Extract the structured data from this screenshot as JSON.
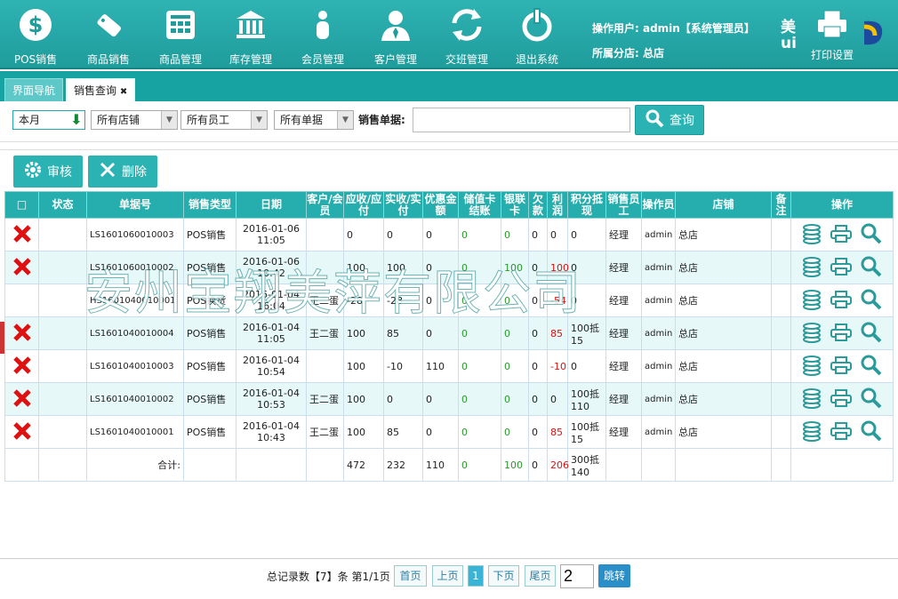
{
  "nav": [
    {
      "label": "POS销售",
      "icon": "dollar-icon"
    },
    {
      "label": "商品销售",
      "icon": "tag-icon"
    },
    {
      "label": "商品管理",
      "icon": "grid-icon"
    },
    {
      "label": "库存管理",
      "icon": "bank-icon"
    },
    {
      "label": "会员管理",
      "icon": "member-icon"
    },
    {
      "label": "客户管理",
      "icon": "customer-icon"
    },
    {
      "label": "交班管理",
      "icon": "swap-icon"
    },
    {
      "label": "退出系统",
      "icon": "exit-icon"
    }
  ],
  "user": {
    "operator": "操作用户: admin【系统管理员】",
    "branch": "所属分店: 总店"
  },
  "brand": "美ui",
  "print_label": "打印设置",
  "tabs": {
    "nav": "界面导航",
    "sales": "销售查询",
    "close": "✖"
  },
  "filters": {
    "month": "本月",
    "store": "所有店铺",
    "employee": "所有员工",
    "doc": "所有单据",
    "doc_label": "销售单据:",
    "doc_value": "",
    "query": "查询"
  },
  "actions": {
    "audit": "审核",
    "delete": "删除"
  },
  "columns": [
    "",
    "状态",
    "单据号",
    "销售类型",
    "日期",
    "客户/会员",
    "应收/应付",
    "实收/实付",
    "优惠金额",
    "储值卡结账",
    "银联卡",
    "欠款",
    "利润",
    "积分抵现",
    "销售员工",
    "操作员",
    "店铺",
    "备注",
    "操作"
  ],
  "rows": [
    {
      "del": true,
      "status": "",
      "no": "LS1601060010003",
      "type": "POS销售",
      "date": "2016-01-06",
      "time": "11:05",
      "cust": "",
      "due": "0",
      "paid": "0",
      "disc": "0",
      "card": "0",
      "union": "0",
      "debt": "0",
      "profit": "0",
      "points": "0",
      "staff": "经理",
      "op": "admin",
      "store": "总店",
      "note": ""
    },
    {
      "del": true,
      "status": "",
      "no": "LS1601060010002",
      "type": "POS销售",
      "date": "2016-01-06",
      "time": "10:42",
      "cust": "",
      "due": "100",
      "paid": "100",
      "disc": "0",
      "card": "0",
      "union": "100",
      "debt": "0",
      "profit": "100",
      "points": "0",
      "staff": "经理",
      "op": "admin",
      "store": "总店",
      "note": ""
    },
    {
      "del": false,
      "status": "",
      "no": "HS1601040010001",
      "type": "POS换货",
      "date": "2016-01-04",
      "time": "16:04",
      "cust": "王二蛋",
      "due": "-28",
      "paid": "-28",
      "disc": "0",
      "card": "0",
      "union": "0",
      "debt": "0",
      "profit": "-54",
      "points": "0",
      "staff": "经理",
      "op": "admin",
      "store": "总店",
      "note": ""
    },
    {
      "del": true,
      "status": "",
      "no": "LS1601040010004",
      "type": "POS销售",
      "date": "2016-01-04",
      "time": "11:05",
      "cust": "王二蛋",
      "due": "100",
      "paid": "85",
      "disc": "0",
      "card": "0",
      "union": "0",
      "debt": "0",
      "profit": "85",
      "points": "100抵15",
      "staff": "经理",
      "op": "admin",
      "store": "总店",
      "note": ""
    },
    {
      "del": true,
      "status": "",
      "no": "LS1601040010003",
      "type": "POS销售",
      "date": "2016-01-04",
      "time": "10:54",
      "cust": "",
      "due": "100",
      "paid": "-10",
      "disc": "110",
      "card": "0",
      "union": "0",
      "debt": "0",
      "profit": "-10",
      "points": "0",
      "staff": "经理",
      "op": "admin",
      "store": "总店",
      "note": ""
    },
    {
      "del": true,
      "status": "",
      "no": "LS1601040010002",
      "type": "POS销售",
      "date": "2016-01-04",
      "time": "10:53",
      "cust": "王二蛋",
      "due": "100",
      "paid": "0",
      "disc": "0",
      "card": "0",
      "union": "0",
      "debt": "0",
      "profit": "0",
      "points": "100抵110",
      "staff": "经理",
      "op": "admin",
      "store": "总店",
      "note": ""
    },
    {
      "del": true,
      "status": "",
      "no": "LS1601040010001",
      "type": "POS销售",
      "date": "2016-01-04",
      "time": "10:43",
      "cust": "王二蛋",
      "due": "100",
      "paid": "85",
      "disc": "0",
      "card": "0",
      "union": "0",
      "debt": "0",
      "profit": "85",
      "points": "100抵15",
      "staff": "经理",
      "op": "admin",
      "store": "总店",
      "note": ""
    }
  ],
  "total": {
    "label": "合计:",
    "due": "472",
    "paid": "232",
    "disc": "110",
    "card": "0",
    "union": "100",
    "debt": "0",
    "profit": "206",
    "points": "300抵140"
  },
  "watermark": "安州宝翔美萍有限公司",
  "pager": {
    "text": "总记录数【7】条 第1/1页",
    "first": "首页",
    "prev": "上页",
    "cur": "1",
    "next": "下页",
    "last": "尾页",
    "input": "2",
    "go": "跳转"
  }
}
